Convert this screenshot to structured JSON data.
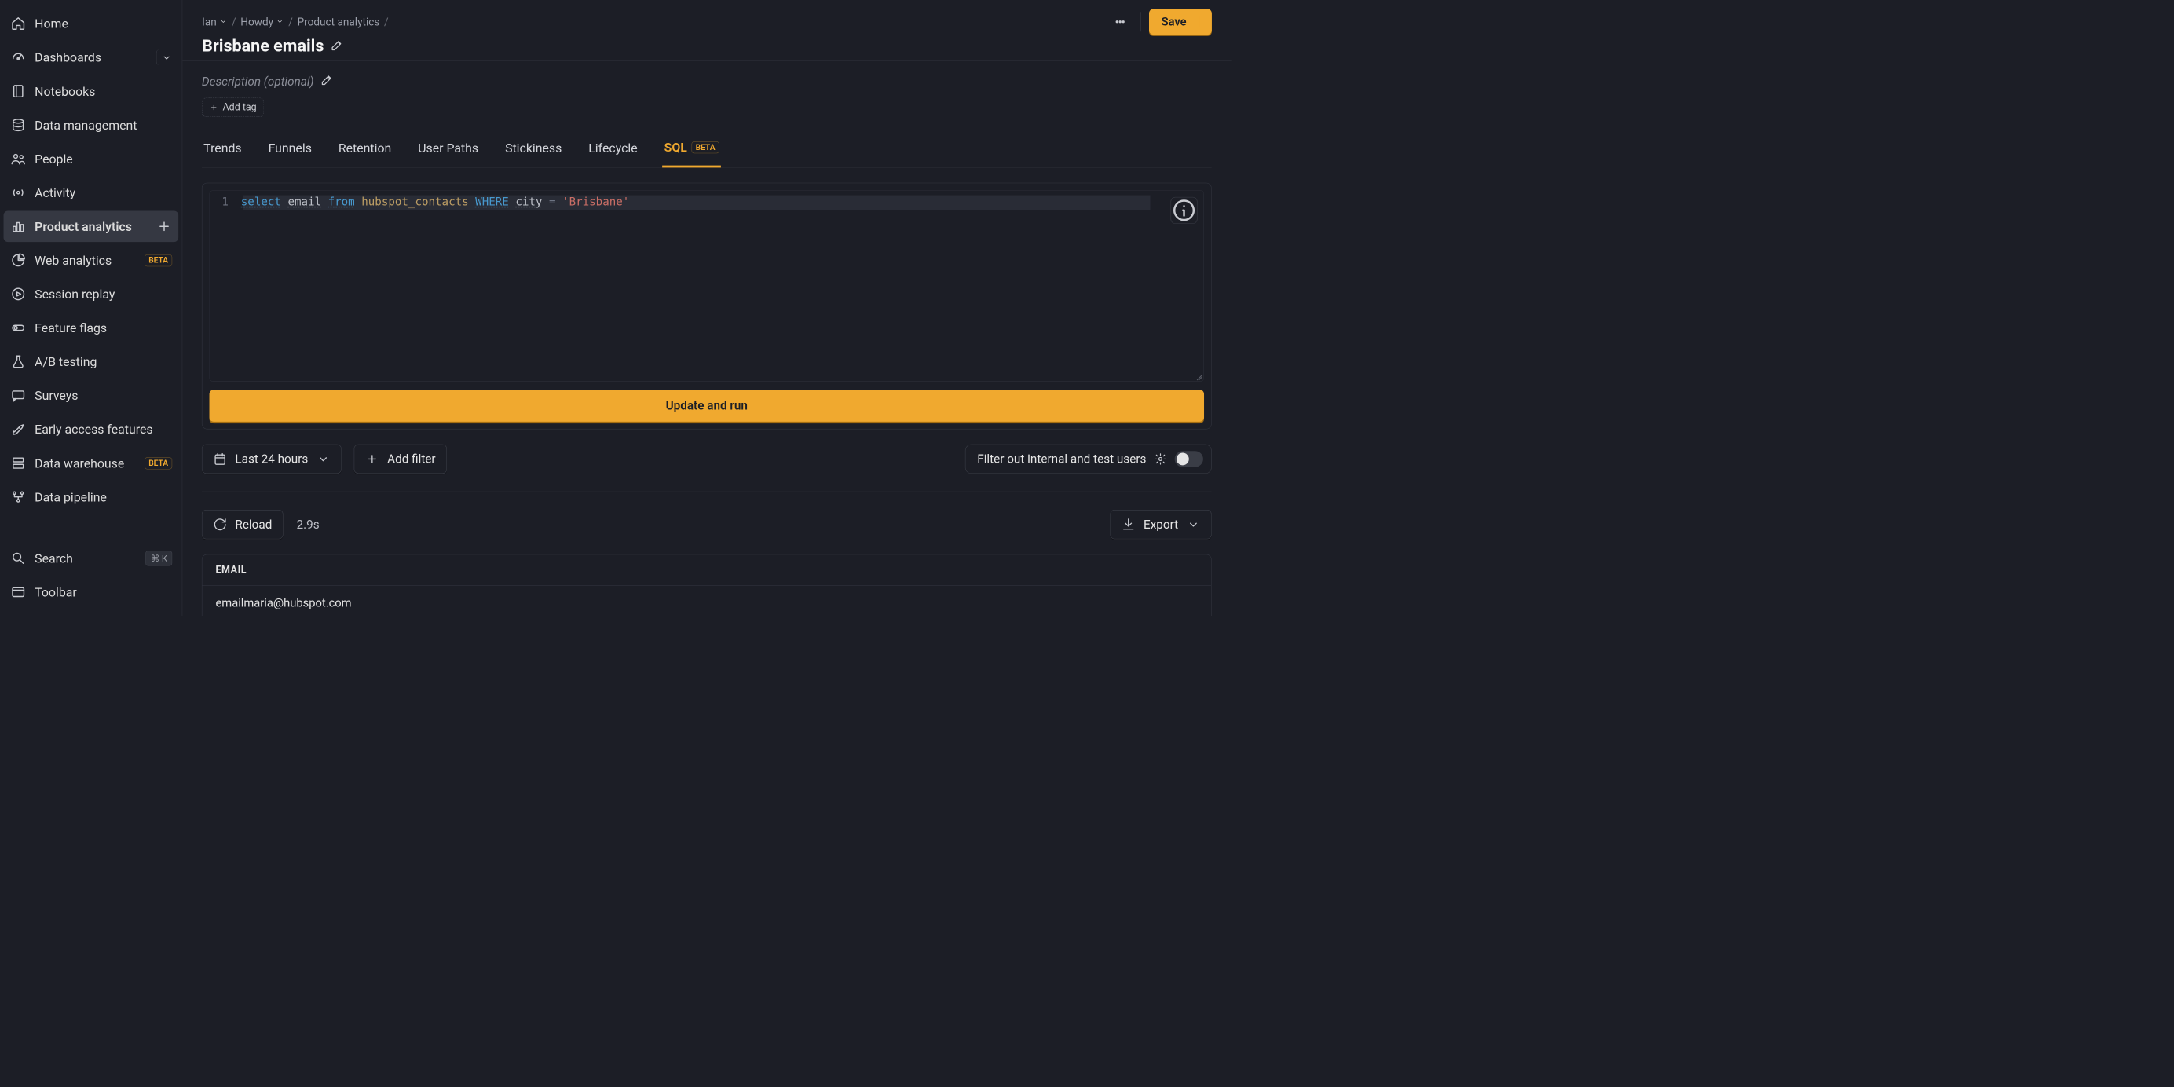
{
  "sidebar": {
    "items": [
      {
        "label": "Home"
      },
      {
        "label": "Dashboards"
      },
      {
        "label": "Notebooks"
      },
      {
        "label": "Data management"
      },
      {
        "label": "People"
      },
      {
        "label": "Activity"
      },
      {
        "label": "Product analytics"
      },
      {
        "label": "Web analytics",
        "beta": true
      },
      {
        "label": "Session replay"
      },
      {
        "label": "Feature flags"
      },
      {
        "label": "A/B testing"
      },
      {
        "label": "Surveys"
      },
      {
        "label": "Early access features"
      },
      {
        "label": "Data warehouse",
        "beta": true
      },
      {
        "label": "Data pipeline"
      }
    ],
    "search_label": "Search",
    "search_kbd": "⌘ K",
    "toolbar_label": "Toolbar",
    "beta_label": "BETA"
  },
  "breadcrumbs": {
    "items": [
      "Ian",
      "Howdy",
      "Product analytics"
    ]
  },
  "header": {
    "title": "Brisbane emails",
    "save_label": "Save"
  },
  "description": {
    "placeholder": "Description (optional)",
    "add_tag": "Add tag"
  },
  "tabs": {
    "items": [
      "Trends",
      "Funnels",
      "Retention",
      "User Paths",
      "Stickiness",
      "Lifecycle",
      "SQL"
    ],
    "active_index": 6,
    "sql_beta": "BETA"
  },
  "editor": {
    "line_no": "1",
    "sql": {
      "k1": "select",
      "c1": "email",
      "k2": "from",
      "t1": "hubspot_contacts",
      "k3": "WHERE",
      "c2": "city",
      "op": "=",
      "s1": "'Brisbane'"
    },
    "run_label": "Update and run"
  },
  "filters": {
    "date_label": "Last 24 hours",
    "add_filter": "Add filter",
    "filter_users": "Filter out internal and test users"
  },
  "results": {
    "reload": "Reload",
    "timing": "2.9s",
    "export": "Export",
    "column_header": "EMAIL",
    "rows": [
      "emailmaria@hubspot.com"
    ]
  }
}
